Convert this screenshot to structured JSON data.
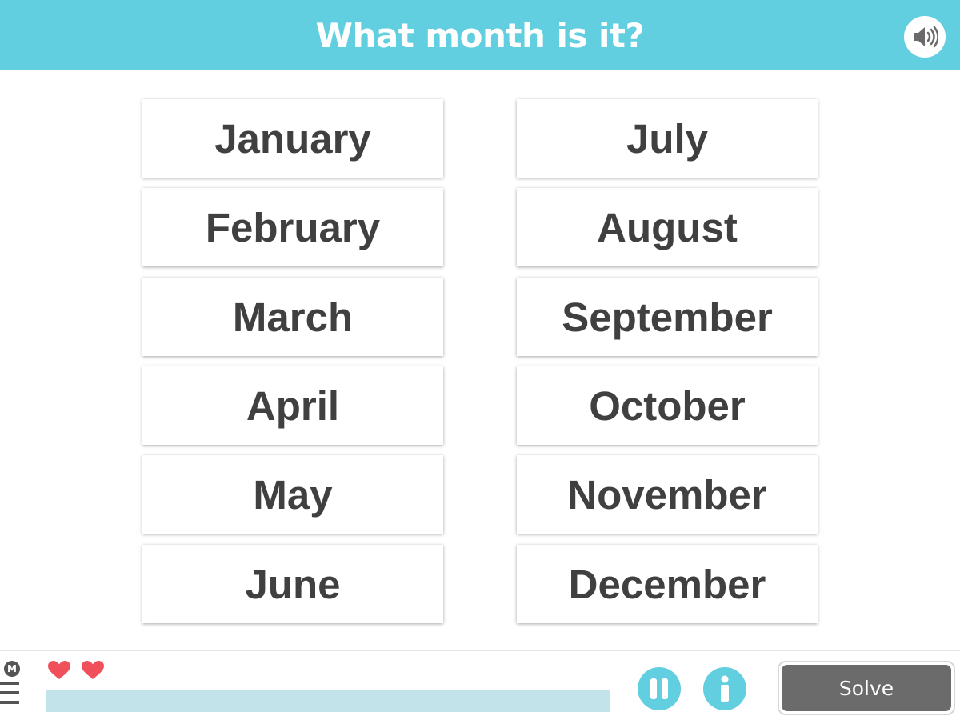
{
  "header": {
    "title": "What month is it?",
    "background_color": "#62cfe0",
    "sound_icon": "speaker-icon"
  },
  "choices": {
    "left": [
      "January",
      "February",
      "March",
      "April",
      "May",
      "June"
    ],
    "right": [
      "July",
      "August",
      "September",
      "October",
      "November",
      "December"
    ]
  },
  "footer": {
    "menu_badge": "M",
    "lives": 2,
    "heart_color": "#f0505a",
    "progress_fraction": 0.0,
    "progress_track_color": "#c3e3ea",
    "pause_icon": "pause-icon",
    "info_icon": "info-icon",
    "solve_label": "Solve"
  }
}
